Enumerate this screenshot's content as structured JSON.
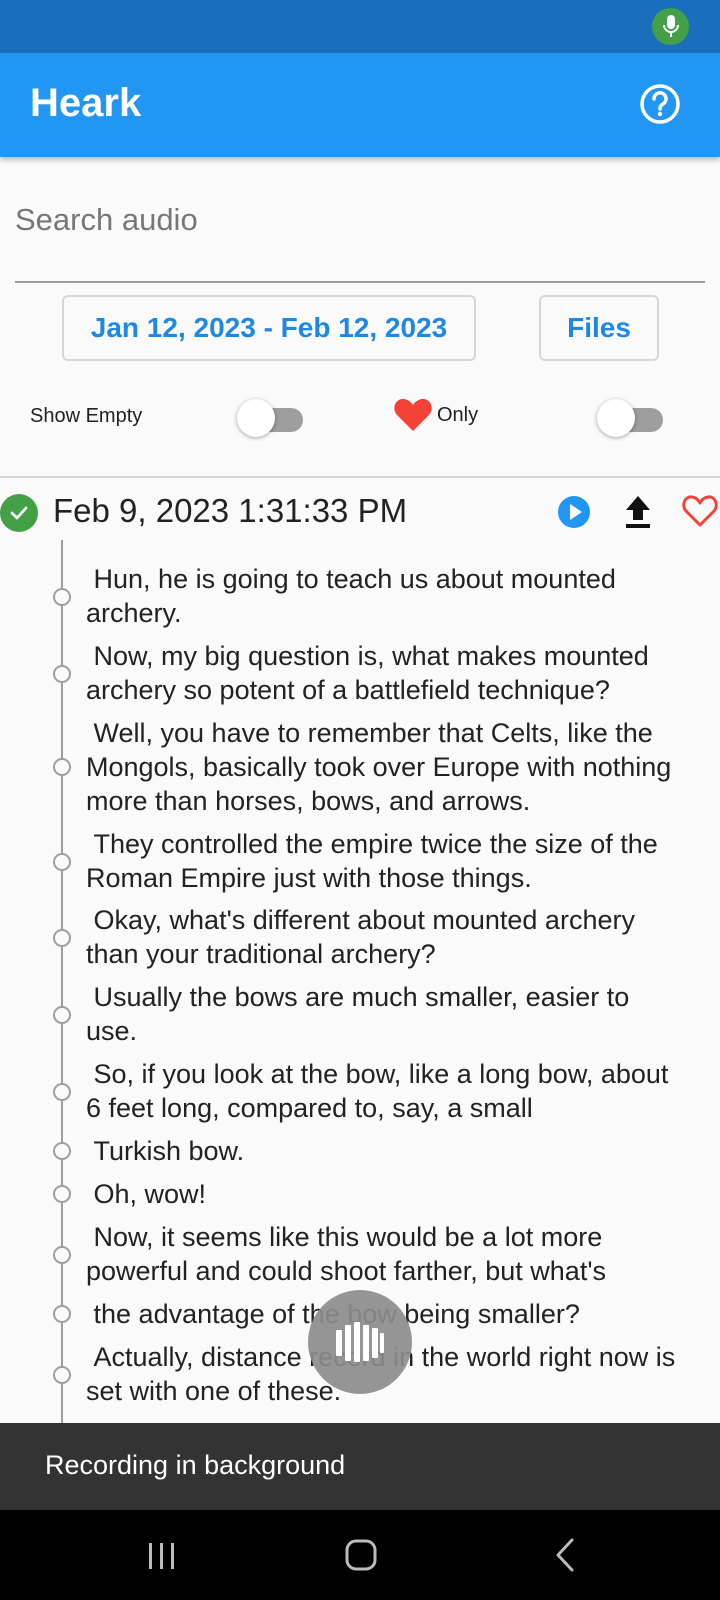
{
  "app": {
    "title": "Heark"
  },
  "search": {
    "placeholder": "Search audio",
    "value": ""
  },
  "filters": {
    "date_range": "Jan 12, 2023 - Feb 12, 2023",
    "files_label": "Files",
    "show_empty_label": "Show Empty",
    "show_empty_on": false,
    "favorites_only_label": "Only",
    "favorites_only_on": false
  },
  "recording": {
    "timestamp": "Feb 9, 2023 1:31:33 PM",
    "status": "done",
    "favorited": false,
    "transcript": [
      " Hun, he is going to teach us about mounted\narchery.",
      " Now, my big question is, what makes mounted\narchery so potent of a battlefield technique?",
      " Well, you have to remember that Celts, like the\nMongols, basically took over Europe with nothing\nmore than horses, bows, and arrows.",
      " They controlled the empire twice the size of the\nRoman Empire just with those things.",
      " Okay, what's different about mounted archery\nthan your traditional archery?",
      " Usually the bows are much smaller, easier to\nuse.",
      " So, if you look at the bow, like a long bow, about\n6 feet long, compared to, say, a small",
      " Turkish bow.",
      " Oh, wow!",
      " Now, it seems like this would be a lot more\npowerful and could shoot farther, but what's",
      " the advantage of the bow being smaller?",
      " Actually, distance record in the world right now is\nset with one of these."
    ]
  },
  "snackbar": {
    "message": "Recording in background"
  },
  "colors": {
    "primary": "#2196f3",
    "status_bar": "#1a6fbd",
    "accent_text": "#1e88e5",
    "success": "#43a047",
    "heart": "#f44336"
  },
  "icons": [
    "mic-icon",
    "help-icon",
    "heart-icon",
    "check-icon",
    "play-icon",
    "upload-icon",
    "heart-outline-icon",
    "waveform-icon",
    "nav-recents-icon",
    "nav-home-icon",
    "nav-back-icon"
  ]
}
